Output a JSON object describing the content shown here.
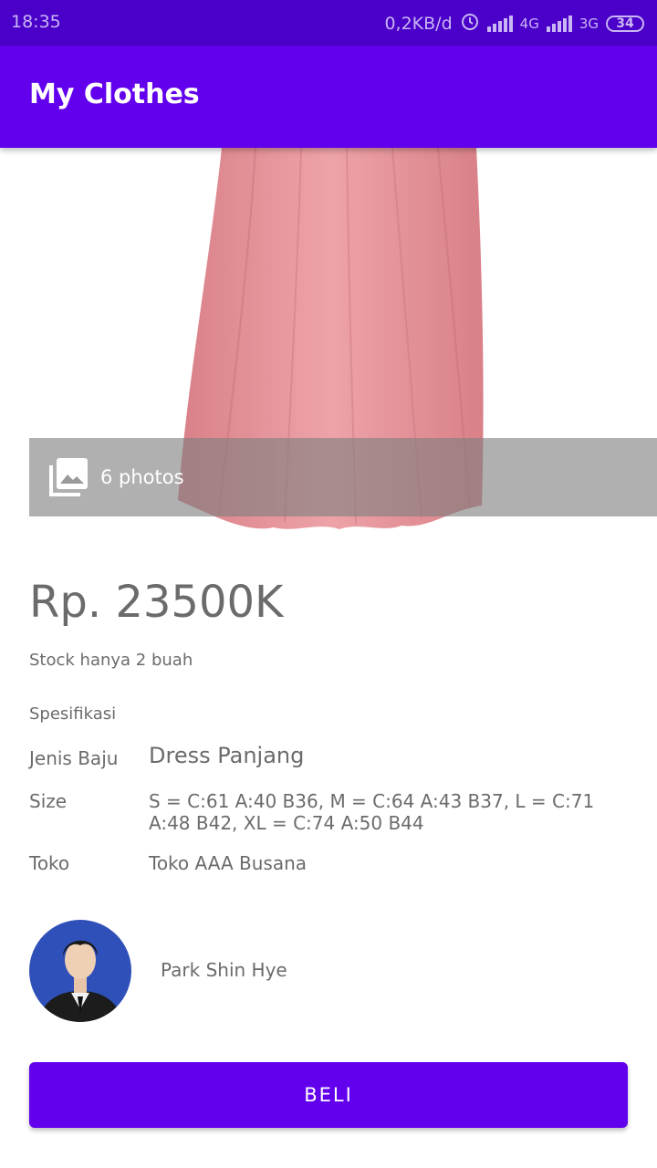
{
  "status_bar": {
    "time": "18:35",
    "net_speed": "0,2KB/d",
    "signal1_label": "4G",
    "signal2_label": "3G",
    "battery": "34"
  },
  "app_bar": {
    "title": "My Clothes"
  },
  "product": {
    "photos_label": "6 photos",
    "price": "Rp. 23500K",
    "stock": "Stock hanya 2 buah",
    "spec_title": "Spesifikasi",
    "specs": [
      {
        "label": "Jenis Baju",
        "value": "Dress Panjang"
      },
      {
        "label": "Size",
        "value": "S = C:61 A:40 B36, M = C:64 A:43 B37, L = C:71 A:48 B42, XL = C:74 A:50 B44"
      },
      {
        "label": "Toko",
        "value": "Toko AAA Busana"
      }
    ]
  },
  "seller": {
    "name": "Park Shin Hye"
  },
  "buy_button": {
    "label": "BELI"
  },
  "colors": {
    "primary": "#6200ee",
    "status_bar": "#4a00c8",
    "dress": "#e8949a"
  }
}
